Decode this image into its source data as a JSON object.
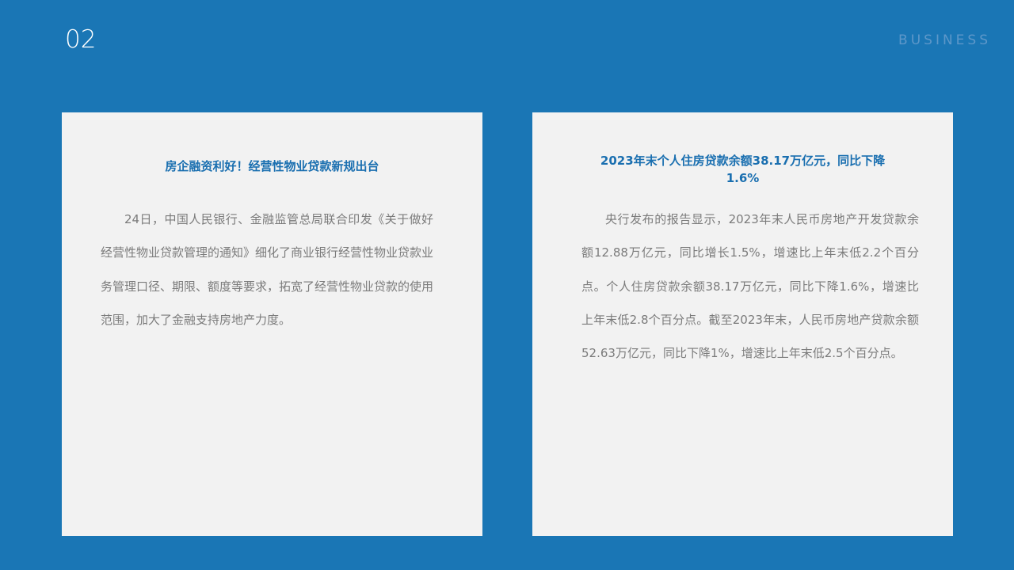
{
  "header": {
    "slide_number": "02",
    "section_label": "BUSINESS"
  },
  "cards": [
    {
      "title": "房企融资利好！经营性物业贷款新规出台",
      "body": "24日，中国人民银行、金融监管总局联合印发《关于做好经营性物业贷款管理的通知》细化了商业银行经营性物业贷款业务管理口径、期限、额度等要求，拓宽了经营性物业贷款的使用范围，加大了金融支持房地产力度。"
    },
    {
      "title": "2023年末个人住房贷款余额38.17万亿元，同比下降1.6%",
      "body": "央行发布的报告显示，2023年末人民币房地产开发贷款余额12.88万亿元，同比增长1.5%，增速比上年末低2.2个百分点。个人住房贷款余额38.17万亿元，同比下降1.6%，增速比上年末低2.8个百分点。截至2023年末，人民币房地产贷款余额52.63万亿元，同比下降1%，增速比上年末低2.5个百分点。"
    }
  ],
  "colors": {
    "background": "#1a76b5",
    "card": "#f2f2f2",
    "title": "#1a6fb0",
    "body_text": "#7b7b7b"
  }
}
